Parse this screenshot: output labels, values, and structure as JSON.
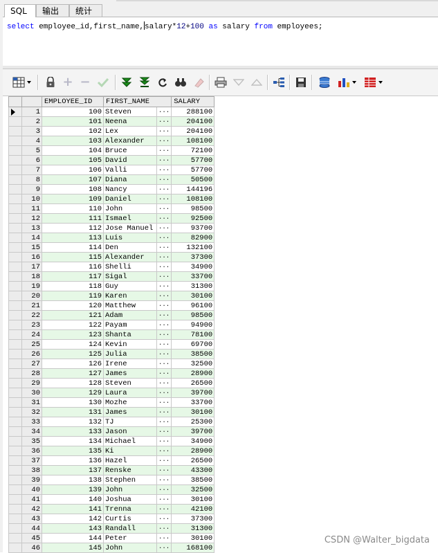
{
  "tabs": [
    {
      "label": "SQL"
    },
    {
      "label": "输出"
    },
    {
      "label": "统计"
    }
  ],
  "editor": {
    "sql": "select employee_id,first_name,salary*12+100 as salary from employees;"
  },
  "toolbar": {
    "icons": [
      "grid-menu-icon",
      "lock-icon",
      "add-record-icon",
      "delete-record-icon",
      "post-changes-icon",
      "next-page-icon",
      "last-page-icon",
      "refresh-icon",
      "find-icon",
      "clear-icon",
      "print-icon",
      "sort-desc-icon",
      "sort-asc-icon",
      "tree-icon",
      "save-icon",
      "export-icon",
      "chart-icon",
      "table-view-icon"
    ]
  },
  "grid": {
    "columns": [
      "EMPLOYEE_ID",
      "FIRST_NAME",
      "SALARY"
    ],
    "rows": [
      [
        "1",
        "100",
        "Steven",
        "288100"
      ],
      [
        "2",
        "101",
        "Neena",
        "204100"
      ],
      [
        "3",
        "102",
        "Lex",
        "204100"
      ],
      [
        "4",
        "103",
        "Alexander",
        "108100"
      ],
      [
        "5",
        "104",
        "Bruce",
        "72100"
      ],
      [
        "6",
        "105",
        "David",
        "57700"
      ],
      [
        "7",
        "106",
        "Valli",
        "57700"
      ],
      [
        "8",
        "107",
        "Diana",
        "50500"
      ],
      [
        "9",
        "108",
        "Nancy",
        "144196"
      ],
      [
        "10",
        "109",
        "Daniel",
        "108100"
      ],
      [
        "11",
        "110",
        "John",
        "98500"
      ],
      [
        "12",
        "111",
        "Ismael",
        "92500"
      ],
      [
        "13",
        "112",
        "Jose Manuel",
        "93700"
      ],
      [
        "14",
        "113",
        "Luis",
        "82900"
      ],
      [
        "15",
        "114",
        "Den",
        "132100"
      ],
      [
        "16",
        "115",
        "Alexander",
        "37300"
      ],
      [
        "17",
        "116",
        "Shelli",
        "34900"
      ],
      [
        "18",
        "117",
        "Sigal",
        "33700"
      ],
      [
        "19",
        "118",
        "Guy",
        "31300"
      ],
      [
        "20",
        "119",
        "Karen",
        "30100"
      ],
      [
        "21",
        "120",
        "Matthew",
        "96100"
      ],
      [
        "22",
        "121",
        "Adam",
        "98500"
      ],
      [
        "23",
        "122",
        "Payam",
        "94900"
      ],
      [
        "24",
        "123",
        "Shanta",
        "78100"
      ],
      [
        "25",
        "124",
        "Kevin",
        "69700"
      ],
      [
        "26",
        "125",
        "Julia",
        "38500"
      ],
      [
        "27",
        "126",
        "Irene",
        "32500"
      ],
      [
        "28",
        "127",
        "James",
        "28900"
      ],
      [
        "29",
        "128",
        "Steven",
        "26500"
      ],
      [
        "30",
        "129",
        "Laura",
        "39700"
      ],
      [
        "31",
        "130",
        "Mozhe",
        "33700"
      ],
      [
        "32",
        "131",
        "James",
        "30100"
      ],
      [
        "33",
        "132",
        "TJ",
        "25300"
      ],
      [
        "34",
        "133",
        "Jason",
        "39700"
      ],
      [
        "35",
        "134",
        "Michael",
        "34900"
      ],
      [
        "36",
        "135",
        "Ki",
        "28900"
      ],
      [
        "37",
        "136",
        "Hazel",
        "26500"
      ],
      [
        "38",
        "137",
        "Renske",
        "43300"
      ],
      [
        "39",
        "138",
        "Stephen",
        "38500"
      ],
      [
        "40",
        "139",
        "John",
        "32500"
      ],
      [
        "41",
        "140",
        "Joshua",
        "30100"
      ],
      [
        "42",
        "141",
        "Trenna",
        "42100"
      ],
      [
        "43",
        "142",
        "Curtis",
        "37300"
      ],
      [
        "44",
        "143",
        "Randall",
        "31300"
      ],
      [
        "45",
        "144",
        "Peter",
        "30100"
      ],
      [
        "46",
        "145",
        "John",
        "168100"
      ]
    ],
    "ellipsis": "···",
    "row_alt_color": "#e6f8e6"
  },
  "watermark": "CSDN @Walter_bigdata"
}
